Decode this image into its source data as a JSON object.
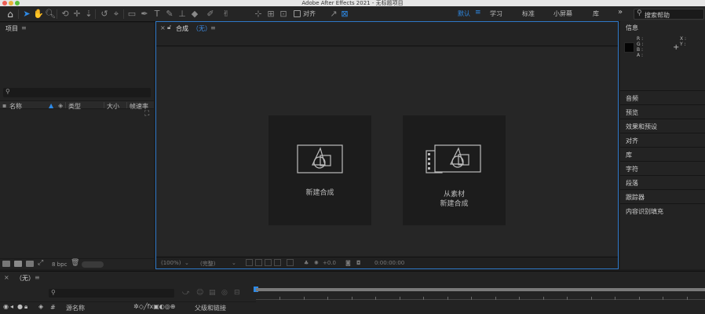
{
  "window": {
    "title": "Adobe After Effects 2021 - 无标题项目"
  },
  "toolbar": {
    "align_label": "对齐",
    "workspaces": [
      {
        "label": "默认",
        "active": true
      },
      {
        "label": "学习",
        "active": false
      },
      {
        "label": "标准",
        "active": false
      },
      {
        "label": "小屏幕",
        "active": false
      },
      {
        "label": "库",
        "active": false
      }
    ],
    "more": "»",
    "search_placeholder": "搜索帮助"
  },
  "project": {
    "title": "项目",
    "columns": {
      "name": "名称",
      "type": "类型",
      "size": "大小",
      "framerate": "帧速率"
    },
    "bpc": "8 bpc"
  },
  "comp": {
    "tab_label": "合成",
    "tab_value": "（无）",
    "cards": {
      "new_comp": "新建合成",
      "from_footage_line1": "从素材",
      "from_footage_line2": "新建合成"
    },
    "footer": {
      "zoom": "(100%)",
      "resolution": "(完整)",
      "exposure": "+0.0",
      "timecode": "0:00:00:00"
    }
  },
  "info": {
    "title": "信息",
    "rgba": {
      "r": "R :",
      "g": "G :",
      "b": "B :",
      "a": "A :"
    },
    "xy": {
      "x": "X :",
      "y": "Y :"
    }
  },
  "right_panels": [
    "音频",
    "预览",
    "效果和预设",
    "对齐",
    "库",
    "字符",
    "段落",
    "跟踪器",
    "内容识别填充"
  ],
  "timeline": {
    "tab_label": "（无）",
    "columns": {
      "num": "#",
      "source": "源名称",
      "parent": "父级和链接"
    }
  },
  "colors": {
    "accent": "#2e8ae6",
    "comp_border": "#2e78c8",
    "bg": "#1d1d1d"
  }
}
